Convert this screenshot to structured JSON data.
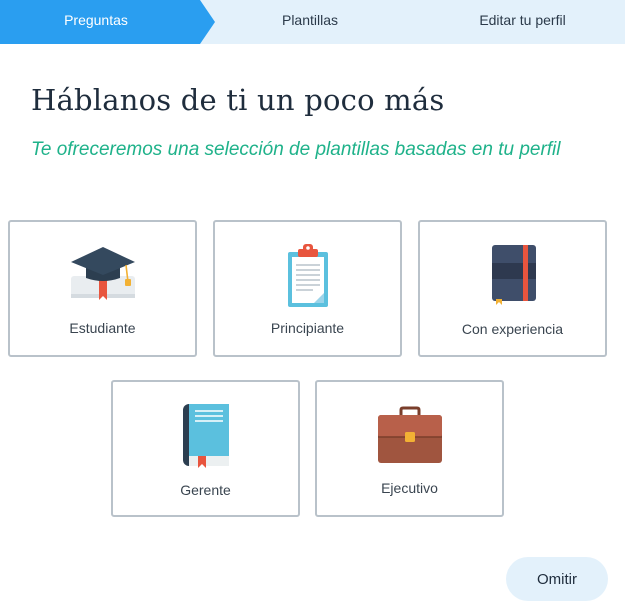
{
  "steps": [
    {
      "label": "Preguntas",
      "active": true
    },
    {
      "label": "Plantillas",
      "active": false
    },
    {
      "label": "Editar tu perfil",
      "active": false
    }
  ],
  "heading": "Háblanos de ti un poco más",
  "subheading": "Te ofreceremos una selección de plantillas basadas en tu perfil",
  "options": [
    {
      "label": "Estudiante",
      "icon": "graduation-cap-icon"
    },
    {
      "label": "Principiante",
      "icon": "clipboard-icon"
    },
    {
      "label": "Con experiencia",
      "icon": "notebook-icon"
    },
    {
      "label": "Gerente",
      "icon": "book-icon"
    },
    {
      "label": "Ejecutivo",
      "icon": "briefcase-icon"
    }
  ],
  "skip_label": "Omitir",
  "colors": {
    "accent": "#2a9ef0",
    "step_bar": "#e3f1fb",
    "subtitle": "#1fb28a",
    "card_border": "#b9c2ca"
  }
}
